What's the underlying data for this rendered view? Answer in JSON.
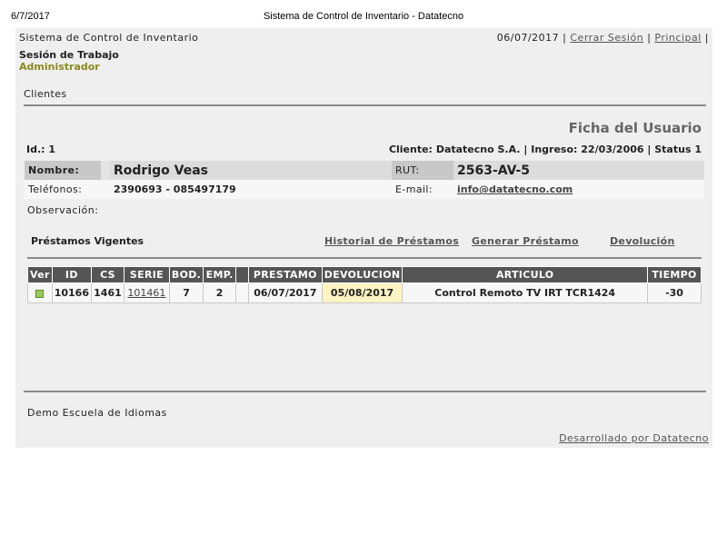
{
  "print_header": {
    "date": "6/7/2017",
    "title": "Sistema de Control de Inventario - Datatecno"
  },
  "header": {
    "app_title": "Sistema de Control de Inventario",
    "date": "06/07/2017",
    "sep": "|",
    "logout_label": "Cerrar Sesión",
    "home_label": "Principal"
  },
  "session": {
    "label": "Sesión de Trabajo",
    "role": "Administrador"
  },
  "section": {
    "label": "Clientes"
  },
  "ficha": {
    "title": "Ficha del Usuario",
    "id_label": "Id.:",
    "id_value": "1",
    "client_label": "Cliente:",
    "client_value": "Datatecno S.A.",
    "ingreso_label": "Ingreso:",
    "ingreso_value": "22/03/2006",
    "status_label": "Status",
    "status_value": "1"
  },
  "user": {
    "nombre_label": "Nombre:",
    "nombre": "Rodrigo Veas",
    "rut_label": "RUT:",
    "rut": "2563-AV-5",
    "telefonos_label": "Teléfonos:",
    "telefonos": "2390693 - 085497179",
    "email_label": "E-mail:",
    "email": "info@datatecno.com",
    "observacion_label": "Observación:"
  },
  "loans": {
    "title": "Préstamos Vigentes",
    "links": {
      "historial": "Historial de Préstamos",
      "generar": "Generar Préstamo",
      "devolucion": "Devolución"
    },
    "columns": [
      "Ver",
      "ID",
      "CS",
      "SERIE",
      "BOD.",
      "EMP.",
      "",
      "PRESTAMO",
      "DEVOLUCION",
      "ARTICULO",
      "TIEMPO"
    ],
    "rows": [
      {
        "ver_icon": "view-square-icon",
        "id": "10166",
        "cs": "1461",
        "serie": "101461",
        "bod": "7",
        "emp": "2",
        "blank": "",
        "prestamo": "06/07/2017",
        "devolucion": "05/08/2017",
        "articulo": "Control Remoto TV IRT TCR1424",
        "tiempo": "-30"
      }
    ]
  },
  "footer": {
    "school": "Demo Escuela de Idiomas",
    "developer": "Desarrollado por Datatecno"
  },
  "colors": {
    "role": "#8a8a1e",
    "table_header_bg": "#555555",
    "due_highlight": "#fcf3c2",
    "ver_icon": "#9acb5a"
  }
}
